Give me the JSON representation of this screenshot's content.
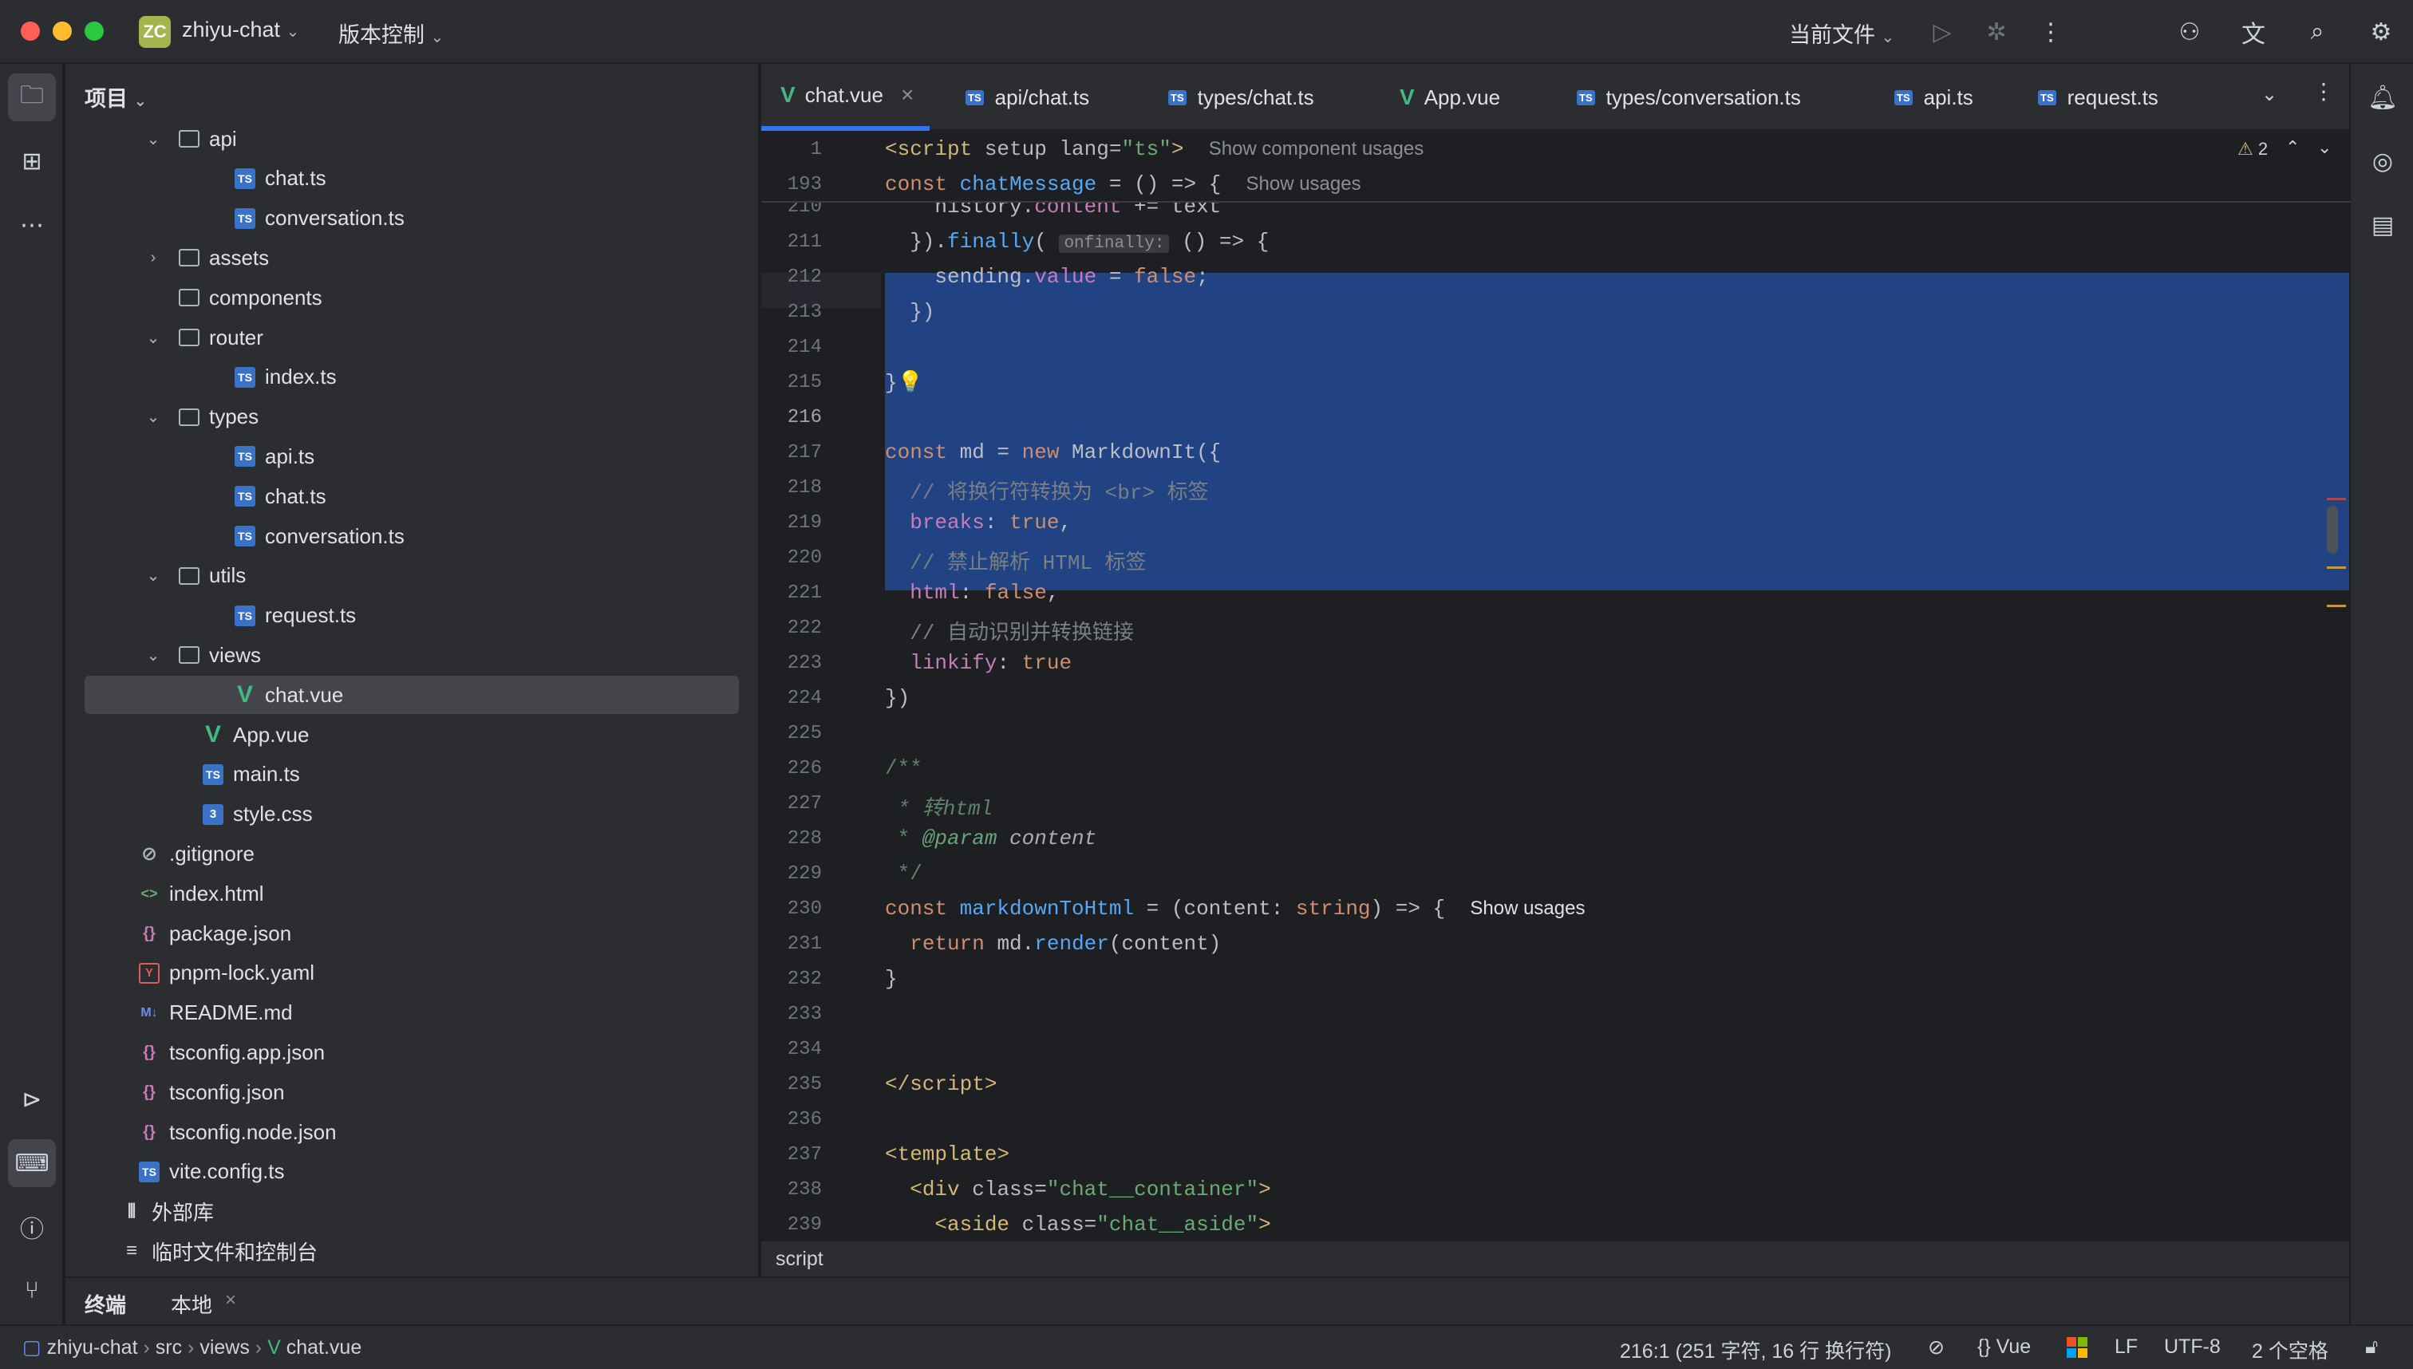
{
  "titlebar": {
    "project_badge": "ZC",
    "project_name": "zhiyu-chat",
    "vcs": "版本控制",
    "run_config": "当前文件"
  },
  "project_panel": {
    "title": "项目",
    "tree": [
      {
        "label": "api",
        "type": "folder",
        "depth": 1,
        "expanded": true
      },
      {
        "label": "chat.ts",
        "type": "ts",
        "depth": 2
      },
      {
        "label": "conversation.ts",
        "type": "ts",
        "depth": 2
      },
      {
        "label": "assets",
        "type": "folder",
        "depth": 1,
        "expanded": false
      },
      {
        "label": "components",
        "type": "folder",
        "depth": 1,
        "expanded": null
      },
      {
        "label": "router",
        "type": "folder",
        "depth": 1,
        "expanded": true
      },
      {
        "label": "index.ts",
        "type": "ts",
        "depth": 2
      },
      {
        "label": "types",
        "type": "folder",
        "depth": 1,
        "expanded": true
      },
      {
        "label": "api.ts",
        "type": "ts",
        "depth": 2
      },
      {
        "label": "chat.ts",
        "type": "ts",
        "depth": 2
      },
      {
        "label": "conversation.ts",
        "type": "ts",
        "depth": 2
      },
      {
        "label": "utils",
        "type": "folder",
        "depth": 1,
        "expanded": true
      },
      {
        "label": "request.ts",
        "type": "ts",
        "depth": 2
      },
      {
        "label": "views",
        "type": "folder",
        "depth": 1,
        "expanded": true
      },
      {
        "label": "chat.vue",
        "type": "vue",
        "depth": 2,
        "selected": true
      },
      {
        "label": "App.vue",
        "type": "vue",
        "depth": 1
      },
      {
        "label": "main.ts",
        "type": "ts",
        "depth": 1
      },
      {
        "label": "style.css",
        "type": "css",
        "depth": 1
      },
      {
        "label": ".gitignore",
        "type": "ignore",
        "depth": 0
      },
      {
        "label": "index.html",
        "type": "html",
        "depth": 0
      },
      {
        "label": "package.json",
        "type": "json",
        "depth": 0
      },
      {
        "label": "pnpm-lock.yaml",
        "type": "yaml",
        "depth": 0
      },
      {
        "label": "README.md",
        "type": "md",
        "depth": 0
      },
      {
        "label": "tsconfig.app.json",
        "type": "json",
        "depth": 0
      },
      {
        "label": "tsconfig.json",
        "type": "json",
        "depth": 0
      },
      {
        "label": "tsconfig.node.json",
        "type": "json",
        "depth": 0
      },
      {
        "label": "vite.config.ts",
        "type": "ts",
        "depth": 0
      },
      {
        "label": "外部库",
        "type": "lib",
        "depth": -1
      },
      {
        "label": "临时文件和控制台",
        "type": "scratch",
        "depth": -1
      }
    ]
  },
  "tabs": [
    {
      "label": "chat.vue",
      "type": "vue",
      "active": true
    },
    {
      "label": "api/chat.ts",
      "type": "ts"
    },
    {
      "label": "types/chat.ts",
      "type": "ts"
    },
    {
      "label": "App.vue",
      "type": "vue"
    },
    {
      "label": "types/conversation.ts",
      "type": "ts"
    },
    {
      "label": "api.ts",
      "type": "ts"
    },
    {
      "label": "request.ts",
      "type": "ts"
    }
  ],
  "editor": {
    "warnings": "2",
    "sticky": [
      {
        "ln": "1",
        "hint": "Show component usages"
      },
      {
        "ln": "193",
        "hint": "Show usages"
      }
    ],
    "line_numbers": [
      "210",
      "211",
      "212",
      "213",
      "214",
      "215",
      "216",
      "217",
      "218",
      "219",
      "220",
      "221",
      "222",
      "223",
      "224",
      "225",
      "226",
      "227",
      "228",
      "229",
      "230",
      "231",
      "232",
      "233",
      "234",
      "235",
      "236",
      "237",
      "238",
      "239"
    ],
    "inlay_onfinally": "onfinally:",
    "hint_show_usages": "Show usages",
    "breadcrumb": "script",
    "comments": {
      "c218": "// 将换行符转换为 <br> 标签",
      "c220": "// 禁止解析 HTML 标签",
      "c222": "// 自动识别并转换链接",
      "c227": " * 转html",
      "c228_tag": "@param",
      "c228_text": " content"
    }
  },
  "bottom": {
    "terminal_tab": "终端",
    "local_tab": "本地"
  },
  "status": {
    "path": [
      "zhiyu-chat",
      "src",
      "views",
      "chat.vue"
    ],
    "position": "216:1 (251 字符, 16 行 换行符)",
    "language": "Vue",
    "line_sep": "LF",
    "encoding": "UTF-8",
    "indent": "2 个空格"
  }
}
